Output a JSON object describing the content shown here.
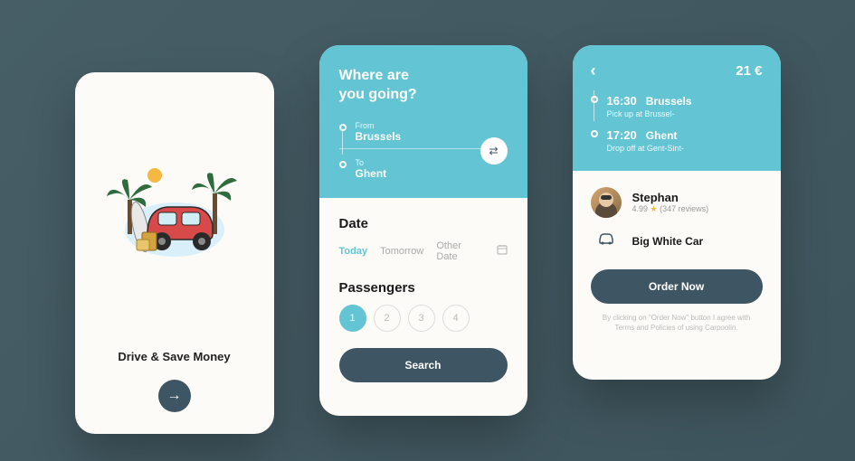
{
  "card1": {
    "tagline": "Drive & Save Money"
  },
  "card2": {
    "heading_line1": "Where are",
    "heading_line2": "you going?",
    "from_label": "From",
    "from_value": "Brussels",
    "to_label": "To",
    "to_value": "Ghent",
    "date_title": "Date",
    "date_options": {
      "today": "Today",
      "tomorrow": "Tomorrow",
      "other": "Other Date"
    },
    "passengers_title": "Passengers",
    "passengers": [
      "1",
      "2",
      "3",
      "4"
    ],
    "search_label": "Search"
  },
  "card3": {
    "price": "21 €",
    "stop1": {
      "time": "16:30",
      "city": "Brussels",
      "detail": "Pick up at Brussel-"
    },
    "stop2": {
      "time": "17:20",
      "city": "Ghent",
      "detail": "Drop off at Gent-Sint-"
    },
    "driver": {
      "name": "Stephan",
      "rating": "4.99",
      "reviews": "(347 reviews)"
    },
    "car": "Big White Car",
    "order_label": "Order Now",
    "disclaimer": "By clicking on \"Order Now\" button I agree with Terms and Policies of using Carpoolin."
  }
}
